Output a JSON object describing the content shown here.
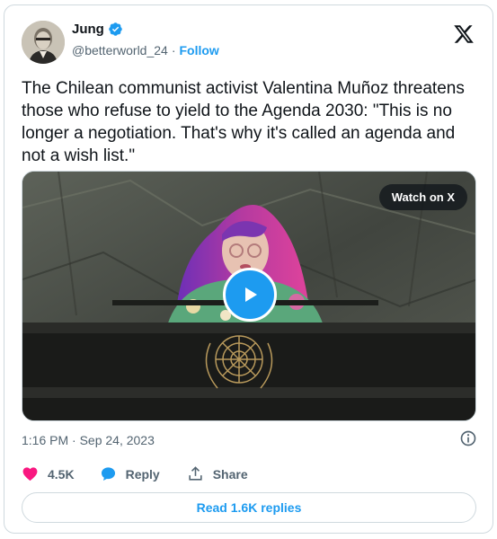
{
  "author": {
    "name": "Jung",
    "handle": "@betterworld_24",
    "separator": "·",
    "follow_label": "Follow"
  },
  "tweet": {
    "text": "The Chilean communist activist Valentina Muñoz threatens those who refuse to yield to the Agenda 2030: \"This is no longer a negotiation. That's why it's called an agenda and not a wish list.\""
  },
  "media": {
    "watch_label": "Watch on X"
  },
  "meta": {
    "timestamp": "1:16 PM · Sep 24, 2023"
  },
  "actions": {
    "like_count": "4.5K",
    "reply_label": "Reply",
    "share_label": "Share"
  },
  "replies": {
    "label": "Read 1.6K replies"
  },
  "colors": {
    "accent": "#1d9bf0",
    "like": "#f91880",
    "muted": "#536471",
    "border": "#cfd9de"
  }
}
